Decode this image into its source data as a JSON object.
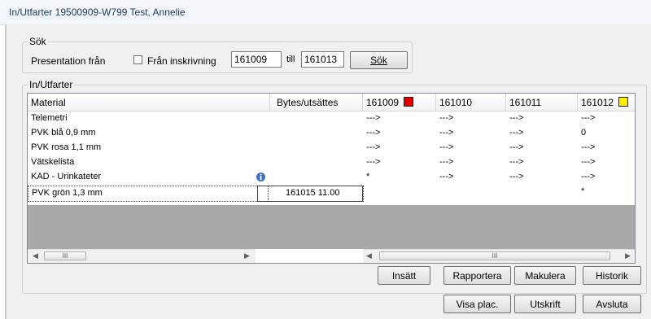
{
  "window": {
    "title": "In/Utfarter 19500909-W799 Test, Annelie"
  },
  "search": {
    "group_label": "Sök",
    "presentation_label": "Presentation från",
    "checkbox_label": "Från inskrivning",
    "checkbox_checked": false,
    "from_value": "161009",
    "till_label": "till",
    "to_value": "161013",
    "search_button": "Sök"
  },
  "inout": {
    "group_label": "In/Utfarter",
    "columns": [
      "Material",
      "Bytes/utsättes",
      "161009",
      "161010",
      "161011",
      "161012"
    ],
    "column_markers": {
      "161009": "#e00000",
      "161012": "#ffee00"
    },
    "rows": [
      {
        "material": "Telemetri",
        "bytes": "",
        "has_info_icon": false,
        "days": [
          "--->",
          "--->",
          "--->",
          "--->"
        ]
      },
      {
        "material": "PVK blå 0,9 mm",
        "bytes": "",
        "has_info_icon": false,
        "days": [
          "--->",
          "--->",
          "--->",
          "0"
        ]
      },
      {
        "material": "PVK rosa 1,1 mm",
        "bytes": "",
        "has_info_icon": false,
        "days": [
          "--->",
          "--->",
          "--->",
          "--->"
        ]
      },
      {
        "material": "Vätskelista",
        "bytes": "",
        "has_info_icon": false,
        "days": [
          "--->",
          "--->",
          "--->",
          "--->"
        ]
      },
      {
        "material": "KAD - Urinkateter",
        "bytes": "",
        "has_info_icon": true,
        "days": [
          "*",
          "--->",
          "--->",
          "--->"
        ]
      },
      {
        "material": "PVK grön 1,3 mm",
        "bytes": "161015 11.00",
        "has_info_icon": false,
        "days": [
          "",
          "",
          "",
          "*"
        ]
      }
    ],
    "selected_row": 5,
    "scroll_thumb_glyph": "III"
  },
  "actions": {
    "insatt": "Insätt",
    "rapportera": "Rapportera",
    "makulera": "Makulera",
    "historik": "Historik"
  },
  "footer": {
    "visa_plac": "Visa plac.",
    "utskrift": "Utskrift",
    "avsluta": "Avsluta"
  }
}
